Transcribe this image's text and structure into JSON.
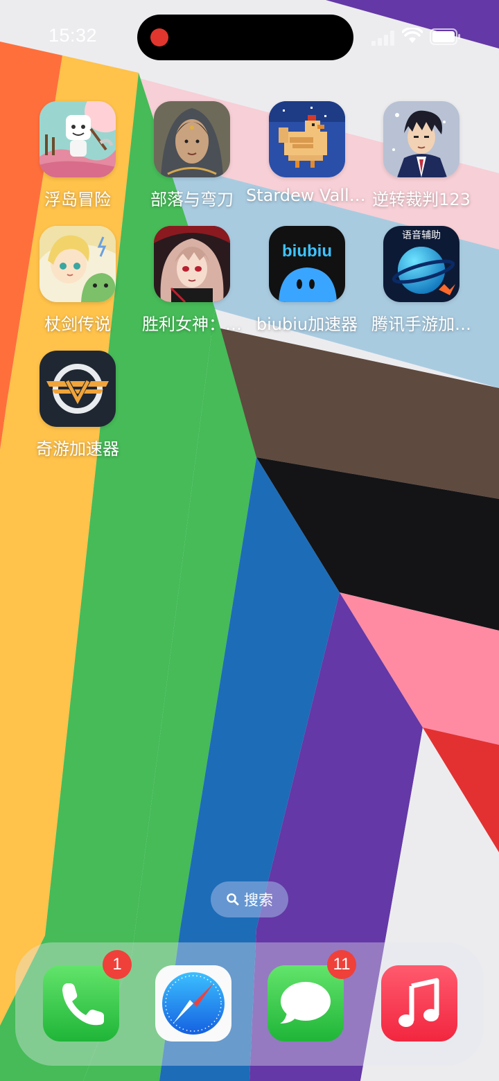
{
  "status_bar": {
    "time": "15:32"
  },
  "apps": [
    {
      "label": "浮岛冒险",
      "icon": "floating-island-game-icon"
    },
    {
      "label": "部落与弯刀",
      "icon": "tribe-and-scimitar-game-icon"
    },
    {
      "label": "Stardew Valley",
      "icon": "stardew-chicken-icon"
    },
    {
      "label": "逆转裁判123",
      "icon": "ace-attorney-icon"
    },
    {
      "label": "杖剑传说",
      "icon": "sword-legend-game-icon"
    },
    {
      "label": "胜利女神：…",
      "icon": "nikke-game-icon"
    },
    {
      "label": "biubiu加速器",
      "icon": "biubiu-accelerator-icon",
      "icon_text": "biubiu"
    },
    {
      "label": "腾讯手游加…",
      "icon": "tencent-game-booster-icon",
      "icon_text": "语音辅助"
    },
    {
      "label": "奇游加速器",
      "icon": "qiyou-accelerator-icon"
    }
  ],
  "search": {
    "label": "搜索",
    "icon": "search-icon"
  },
  "dock": [
    {
      "name": "phone",
      "icon": "phone-icon",
      "badge": "1"
    },
    {
      "name": "safari",
      "icon": "compass-icon",
      "badge": ""
    },
    {
      "name": "messages",
      "icon": "message-bubble-icon",
      "badge": "11"
    },
    {
      "name": "music",
      "icon": "music-note-icon",
      "badge": ""
    }
  ],
  "colors": {
    "orange": "#ff6f3c",
    "yellow": "#ffc24a",
    "green": "#46bb58",
    "blue": "#1d6cb8",
    "purple": "#6438a6",
    "brown": "#5f4a3f",
    "black": "#141416",
    "pink": "#ff8ba3",
    "light_blue": "#a9cbe0",
    "light_pink": "#f7cfd6",
    "red": "#e33131",
    "white": "#ececef"
  }
}
